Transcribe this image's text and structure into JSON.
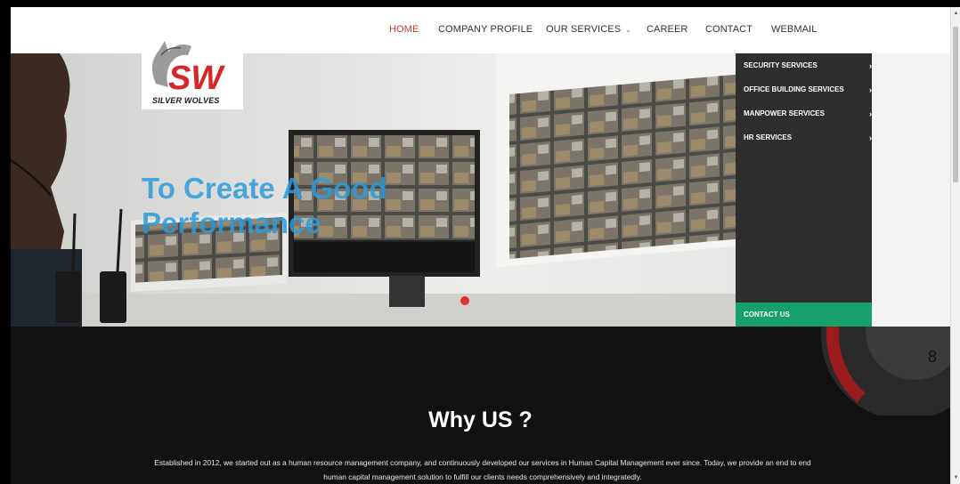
{
  "nav": {
    "items": [
      {
        "label": "HOME",
        "active": true
      },
      {
        "label": "COMPANY PROFILE",
        "active": false
      },
      {
        "label": "OUR SERVICES",
        "active": false,
        "has_dropdown": true
      },
      {
        "label": "CAREER",
        "active": false
      },
      {
        "label": "CONTACT",
        "active": false
      },
      {
        "label": "WEBMAIL",
        "active": false
      }
    ]
  },
  "logo": {
    "monogram": "SW",
    "text": "SILVER WOLVES"
  },
  "hero": {
    "title": "To Create A Good Performance"
  },
  "dropdown": {
    "items": [
      {
        "label": "SECURITY SERVICES",
        "arrow": "›"
      },
      {
        "label": "OFFICE BUILDING SERVICES",
        "arrow": "›"
      },
      {
        "label": "MANPOWER SERVICES",
        "arrow": "›"
      },
      {
        "label": "HR SERVICES",
        "arrow": "›"
      }
    ],
    "contact_label": "CONTACT US"
  },
  "why": {
    "title": "Why US ?",
    "text": "Established in 2012, we started out as a human resource management company, and continuously developed our services in Human Capital Management ever since. Today, we provide an end to end human capital management solution to fulfill our clients needs comprehensively and integratedly."
  },
  "colors": {
    "active_nav": "#c0392b",
    "hero_title": "#2d9cdb",
    "dropdown_bg": "#2e2e2e",
    "contact_bg": "#17a06b",
    "why_bg": "#111111",
    "logo_red": "#d6262a"
  },
  "icons": {
    "dropdown_chevron": "chevron-down-icon",
    "submenu_arrow": "chevron-right-icon"
  }
}
